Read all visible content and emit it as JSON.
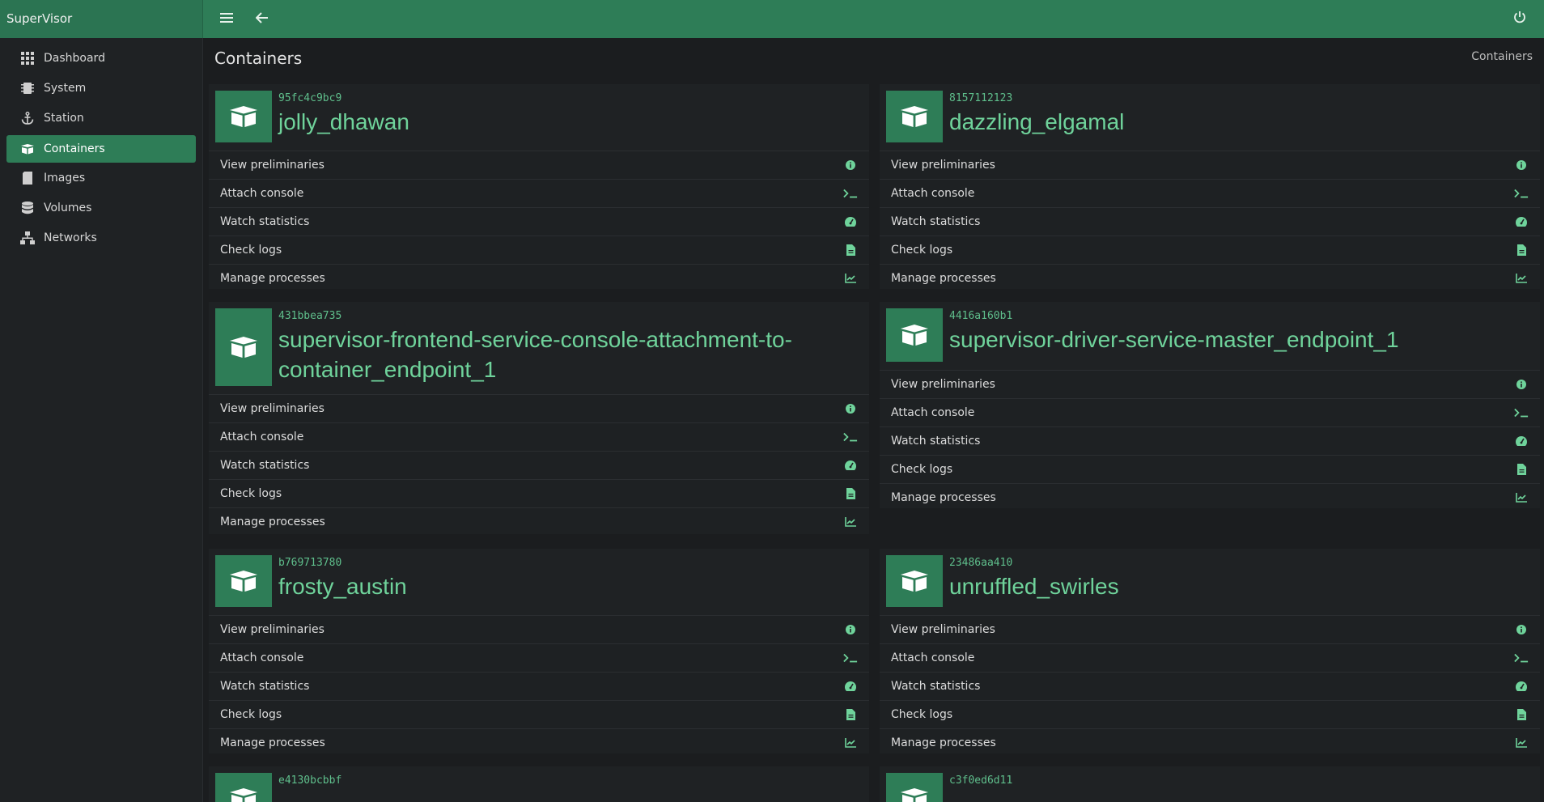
{
  "app": {
    "title": "SuperVisor"
  },
  "sidebar": {
    "items": [
      {
        "label": "Dashboard",
        "icon": "grid-icon"
      },
      {
        "label": "System",
        "icon": "chip-icon"
      },
      {
        "label": "Station",
        "icon": "anchor-icon"
      },
      {
        "label": "Containers",
        "icon": "box-icon",
        "active": true
      },
      {
        "label": "Images",
        "icon": "sd-card-icon"
      },
      {
        "label": "Volumes",
        "icon": "database-icon"
      },
      {
        "label": "Networks",
        "icon": "network-icon"
      }
    ]
  },
  "page": {
    "title": "Containers",
    "breadcrumb": "Containers"
  },
  "actions": [
    "View preliminaries",
    "Attach console",
    "Watch statistics",
    "Check logs",
    "Manage processes"
  ],
  "containers": [
    {
      "id": "95fc4c9bc9",
      "name": "jolly_dhawan"
    },
    {
      "id": "8157112123",
      "name": "dazzling_elgamal"
    },
    {
      "id": "431bbea735",
      "name": "supervisor-frontend-service-console-attachment-to-container_endpoint_1"
    },
    {
      "id": "4416a160b1",
      "name": "supervisor-driver-service-master_endpoint_1"
    },
    {
      "id": "b769713780",
      "name": "frosty_austin"
    },
    {
      "id": "23486aa410",
      "name": "unruffled_swirles"
    },
    {
      "id": "e4130bcbbf",
      "name": ""
    },
    {
      "id": "c3f0ed6d11",
      "name": ""
    }
  ],
  "colors": {
    "accent": "#2e7d57",
    "accent_text": "#6fd39b",
    "background": "#1b1d1f"
  }
}
